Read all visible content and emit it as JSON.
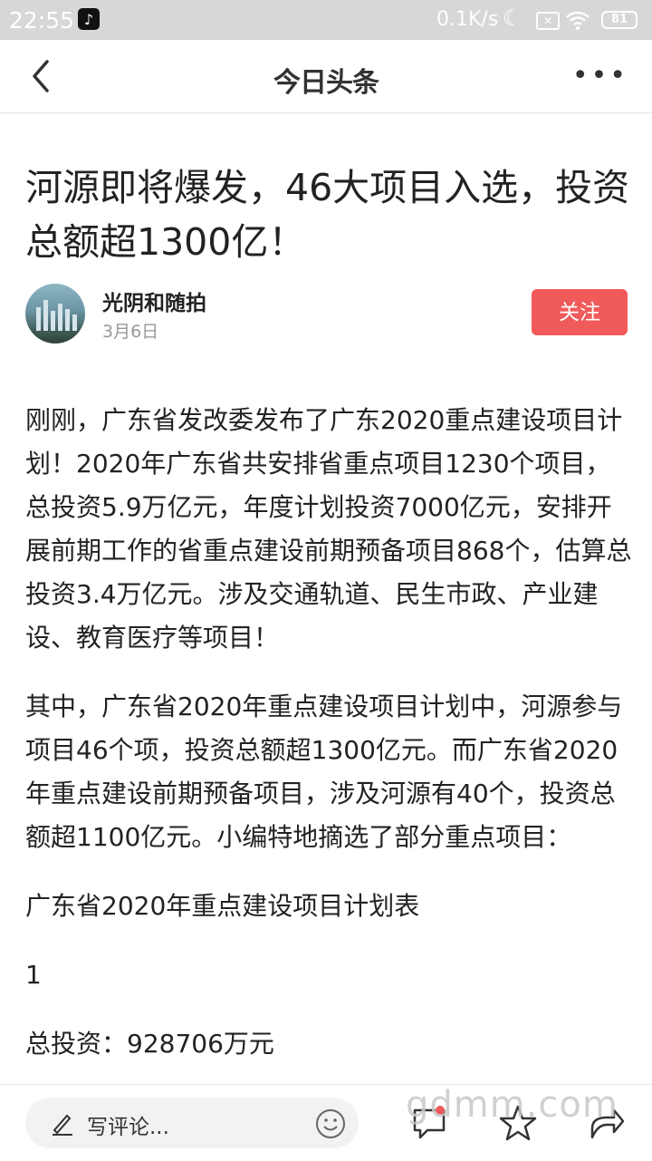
{
  "status_bar": {
    "time": "22:55",
    "network_speed": "0.1K/s",
    "battery": "81"
  },
  "header": {
    "logo_text": "今日头条"
  },
  "article": {
    "title": "河源即将爆发，46大项目入选，投资总额超1300亿！",
    "author": {
      "name": "光阴和随拍",
      "date": "3月6日"
    },
    "follow_label": "关注",
    "paragraphs": [
      "刚刚，广东省发改委发布了广东2020重点建设项目计划！2020年广东省共安排省重点项目1230个项目，总投资5.9万亿元，年度计划投资7000亿元，安排开展前期工作的省重点建设前期预备项目868个，估算总投资3.4万亿元。涉及交通轨道、民生市政、产业建设、教育医疗等项目！",
      "其中，广东省2020年重点建设项目计划中，河源参与项目46个项，投资总额超1300亿元。而广东省2020年重点建设前期预备项目，涉及河源有40个，投资总额超1100亿元。小编特地摘选了部分重点项目：",
      "广东省2020年重点建设项目计划表",
      "1",
      "总投资：928706万元"
    ]
  },
  "bottom_bar": {
    "comment_placeholder": "写评论..."
  },
  "watermark": "gdmm.com",
  "colors": {
    "accent": "#f05a5a",
    "status_bar_bg": "#d7d7d7"
  }
}
